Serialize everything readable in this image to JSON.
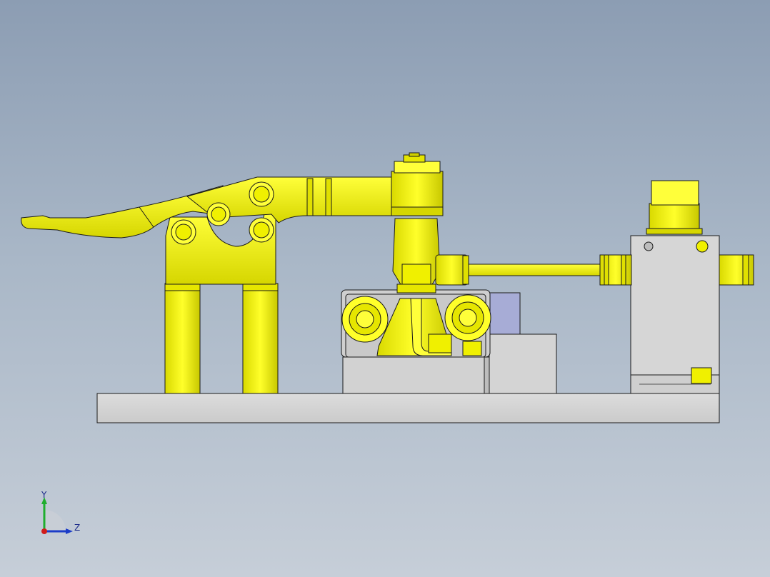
{
  "viewport": {
    "background_top": "#8c9db3",
    "background_bottom": "#c6ced8"
  },
  "model": {
    "part_colors": {
      "clamp": "#f0f000",
      "clamp_shadow": "#b8b800",
      "base_plate": "#d6d6d6",
      "block": "#d2d2d2",
      "outline": "#1a1a1a",
      "bushing": "#a7acd6"
    }
  },
  "triad": {
    "y_label": "Y",
    "z_label": "Z",
    "y_color": "#1fae2e",
    "z_color": "#1b3cc8",
    "x_color": "#d01b1b"
  }
}
